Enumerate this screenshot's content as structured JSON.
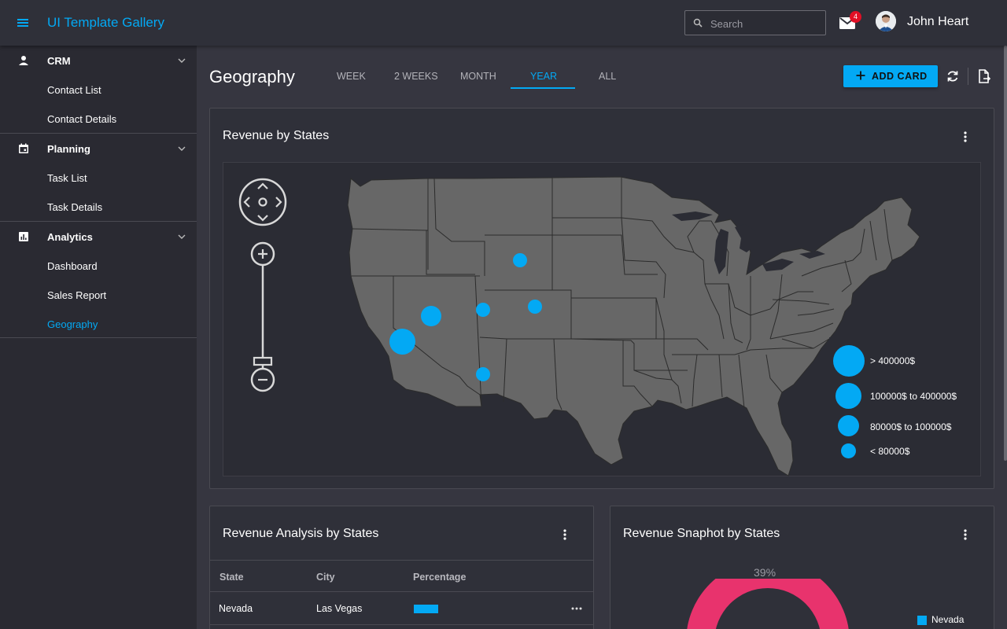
{
  "header": {
    "app_title": "UI Template Gallery",
    "search_placeholder": "Search",
    "mail_badge": "4",
    "user_name": "John Heart"
  },
  "sidebar": {
    "groups": [
      {
        "label": "CRM",
        "icon": "person-icon",
        "items": [
          "Contact List",
          "Contact Details"
        ]
      },
      {
        "label": "Planning",
        "icon": "calendar-icon",
        "items": [
          "Task List",
          "Task Details"
        ]
      },
      {
        "label": "Analytics",
        "icon": "chart-icon",
        "items": [
          "Dashboard",
          "Sales Report",
          "Geography"
        ]
      }
    ],
    "active_item": "Geography"
  },
  "page": {
    "title": "Geography",
    "tabs": [
      "WEEK",
      "2 WEEKS",
      "MONTH",
      "YEAR",
      "ALL"
    ],
    "active_tab": "YEAR",
    "add_card_label": "ADD CARD"
  },
  "map_card": {
    "title": "Revenue by States",
    "legend": [
      {
        "label": "> 400000$"
      },
      {
        "label": "100000$ to 400000$"
      },
      {
        "label": "80000$ to 100000$"
      },
      {
        "label": "< 80000$"
      }
    ],
    "accent_color": "#03a9f4"
  },
  "analysis_card": {
    "title": "Revenue Analysis by States",
    "columns": [
      "State",
      "City",
      "Percentage"
    ],
    "rows": [
      {
        "state": "Nevada",
        "city": "Las Vegas",
        "percentage_fraction": 0.13
      }
    ]
  },
  "snapshot_card": {
    "title": "Revenue Snaphot by States",
    "percent_label": "39%",
    "legend_item": "Nevada",
    "slice_color": "#e8336d",
    "legend_color": "#03a9f4"
  }
}
